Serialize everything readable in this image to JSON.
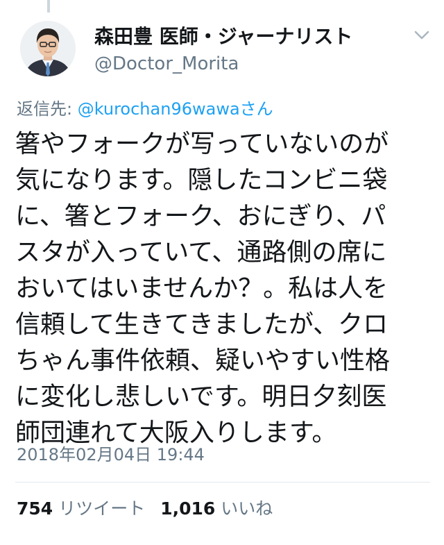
{
  "tweet": {
    "author": {
      "display_name": "森田豊 医師・ジャーナリスト",
      "handle": "@Doctor_Morita"
    },
    "reply_to": {
      "prefix": "返信先: ",
      "mention": "@kurochan96wawa",
      "suffix": "さん"
    },
    "text_lines": [
      "箸やフォークが写っていないのが",
      "気になります。隠したコンビニ袋",
      "に、箸とフォーク、おにぎり、パ",
      "スタが入っていて、通路側の席に",
      "おいてはいませんか？。私は人を",
      "信頼して生きてきましたが、クロ",
      "ちゃん事件依頼、疑いやすい性格",
      "に変化し悲しいです。明日夕刻医",
      "師団連れて大阪入りします。"
    ],
    "timestamp": "2018年02月04日 19:44",
    "stats": {
      "retweet_count": "754",
      "retweet_label": "リツイート",
      "like_count": "1,016",
      "like_label": "いいね"
    }
  },
  "icons": {
    "menu": "chevron-down-icon",
    "avatar": "avatar"
  },
  "colors": {
    "text": "#14171a",
    "secondary": "#657786",
    "link": "#1da1f2",
    "divider": "#e1e8ed"
  }
}
